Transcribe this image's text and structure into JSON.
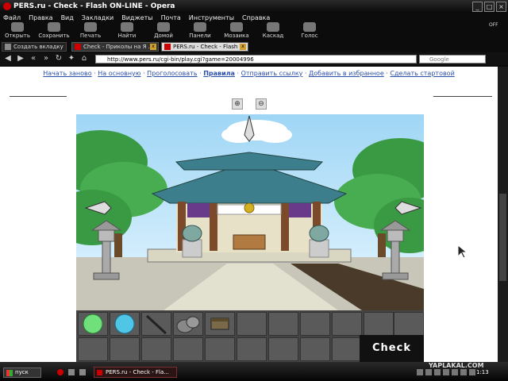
{
  "window": {
    "title": "PERS.ru - Check - Flash ON-LINE - Opera"
  },
  "menu": [
    "Файл",
    "Правка",
    "Вид",
    "Закладки",
    "Виджеты",
    "Почта",
    "Инструменты",
    "Справка"
  ],
  "toolbar": [
    "Открыть",
    "Сохранить",
    "Печать",
    "Найти",
    "Домой",
    "Панели",
    "Мозаика",
    "Каскад",
    "Голос"
  ],
  "toolbar_right": "OFF",
  "tabs": {
    "new_tab": "Создать вкладку",
    "items": [
      {
        "label": "Check - Приколы на Я ..."
      },
      {
        "label": "PERS.ru - Check - Flash ..."
      }
    ]
  },
  "address": {
    "url": "http://www.pers.ru/cgi-bin/play.cgi?game=20004996",
    "search_placeholder": "Google"
  },
  "page_links": [
    {
      "label": "Начать заново"
    },
    {
      "label": "На основную"
    },
    {
      "label": "Проголосовать"
    },
    {
      "label": "Правила",
      "bold": true
    },
    {
      "label": "Отправить ссылку"
    },
    {
      "label": "Добавить в избранное"
    },
    {
      "label": "Сделать стартовой"
    }
  ],
  "zoom": {
    "in_icon": "zoom-in-icon",
    "out_icon": "zoom-out-icon"
  },
  "game": {
    "check_label": "Check",
    "inventory": [
      "green-orb",
      "blue-orb",
      "stick",
      "rocks",
      "treasure-box"
    ]
  },
  "taskbar": {
    "start_label": "пуск",
    "task_label": "PERS.ru - Check - Fla...",
    "watermark": "YAPLAKAL.COM",
    "clock": "1:13"
  },
  "colors": {
    "link": "#2a4fa8",
    "roof": "#3d7e8c",
    "pillar": "#7a4a2a",
    "tree": "#3aa14a",
    "sky": "#cfe9ff"
  }
}
